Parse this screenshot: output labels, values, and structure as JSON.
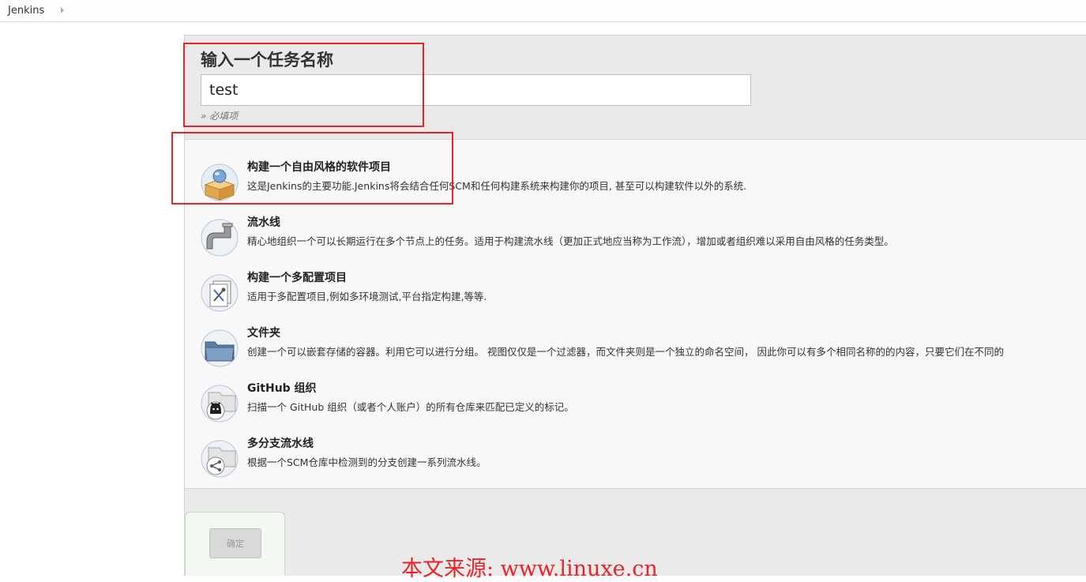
{
  "breadcrumb": {
    "root": "Jenkins"
  },
  "new_item": {
    "title": "输入一个任务名称",
    "name_value": "test",
    "required_note": "» 必填项"
  },
  "items": [
    {
      "icon": "freestyle-project-icon",
      "title": "构建一个自由风格的软件项目",
      "desc": "这是Jenkins的主要功能.Jenkins将会结合任何SCM和任何构建系统来构建你的项目, 甚至可以构建软件以外的系统."
    },
    {
      "icon": "pipeline-icon",
      "title": "流水线",
      "desc": "精心地组织一个可以长期运行在多个节点上的任务。适用于构建流水线（更加正式地应当称为工作流），增加或者组织难以采用自由风格的任务类型。"
    },
    {
      "icon": "multi-config-project-icon",
      "title": "构建一个多配置项目",
      "desc": "适用于多配置项目,例如多环境测试,平台指定构建,等等."
    },
    {
      "icon": "folder-icon",
      "title": "文件夹",
      "desc": "创建一个可以嵌套存储的容器。利用它可以进行分组。 视图仅仅是一个过滤器，而文件夹则是一个独立的命名空间， 因此你可以有多个相同名称的的内容，只要它们在不同的"
    },
    {
      "icon": "github-organization-icon",
      "title": "GitHub 组织",
      "desc": "扫描一个 GitHub 组织（或者个人账户）的所有仓库来匹配已定义的标记。"
    },
    {
      "icon": "multibranch-pipeline-icon",
      "title": "多分支流水线",
      "desc": "根据一个SCM仓库中检测到的分支创建一系列流水线。"
    }
  ],
  "footer": {
    "ok_label": "确定"
  },
  "watermark": "本文来源: www.linuxe.cn",
  "colors": {
    "highlight": "#e8242a",
    "panel": "#eaeaea"
  }
}
